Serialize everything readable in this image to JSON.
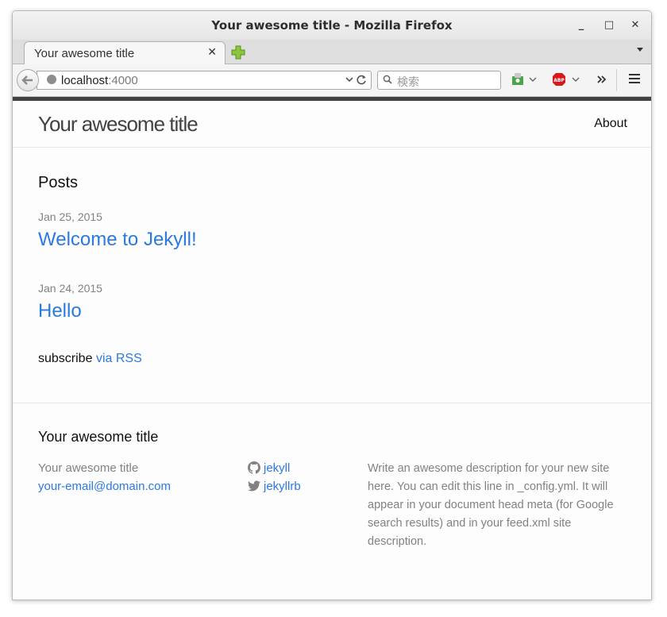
{
  "window": {
    "title": "Your awesome title - Mozilla Firefox",
    "minimize": "_",
    "maximize": "□",
    "close": "✕"
  },
  "tabs": [
    {
      "label": "Your awesome title",
      "close": "✕"
    }
  ],
  "navbar": {
    "url_host": "localhost",
    "url_port": ":4000",
    "search_placeholder": "検索"
  },
  "site": {
    "title": "Your awesome title",
    "nav": {
      "about": "About"
    },
    "posts_heading": "Posts",
    "posts": [
      {
        "date": "Jan 25, 2015",
        "title": "Welcome to Jekyll!"
      },
      {
        "date": "Jan 24, 2015",
        "title": "Hello"
      }
    ],
    "subscribe_prefix": "subscribe",
    "subscribe_link": "via RSS"
  },
  "footer": {
    "heading": "Your awesome title",
    "name": "Your awesome title",
    "email": "your-email@domain.com",
    "github": "jekyll",
    "twitter": "jekyllrb",
    "description": "Write an awesome description for your new site here. You can edit this line in _config.yml. It will appear in your document head meta (for Google search results) and in your feed.xml site description."
  },
  "colors": {
    "link": "#2a7ae2",
    "header_bar": "#424242",
    "muted": "#828282"
  },
  "icons": [
    "back-arrow-icon",
    "globe-icon",
    "reload-icon",
    "search-icon",
    "new-tab-icon",
    "adblock-icon",
    "menu-icon",
    "github-icon",
    "twitter-icon"
  ]
}
